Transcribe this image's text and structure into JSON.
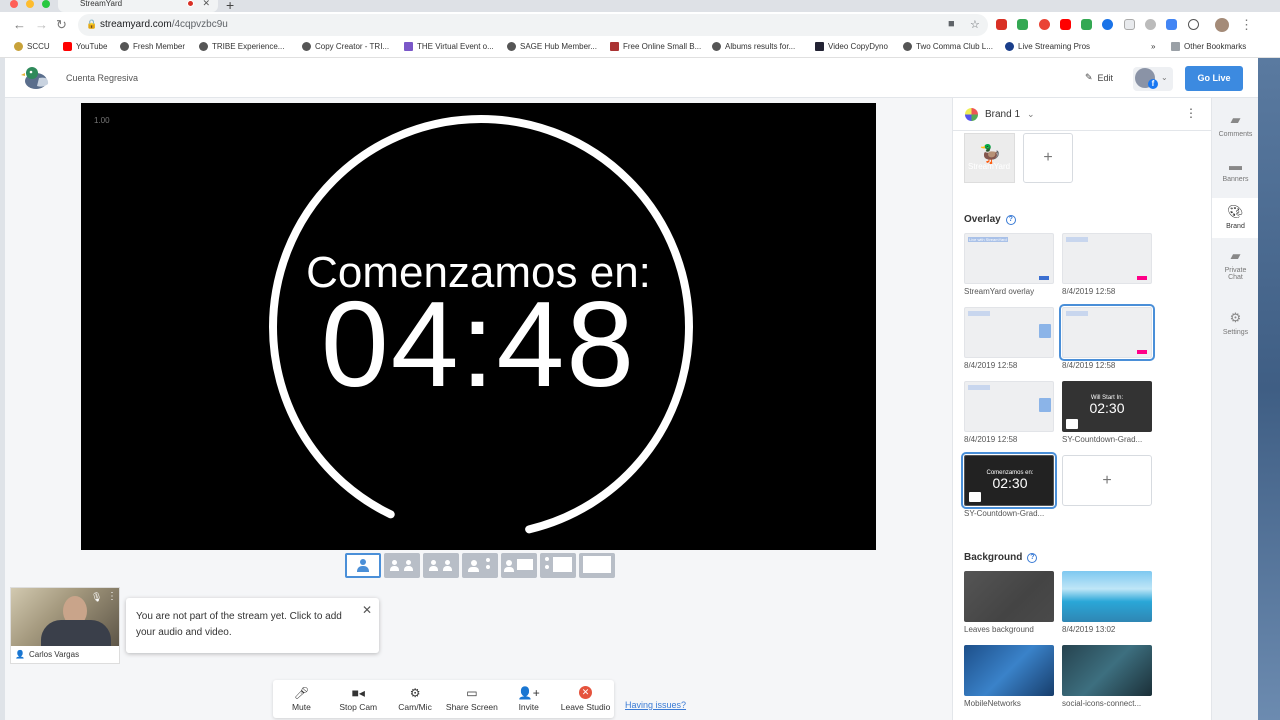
{
  "browser": {
    "tab_title": "StreamYard",
    "url_host": "streamyard.com",
    "url_path": "/4cqpvzbc9u",
    "bookmarks": [
      "SCCU",
      "YouTube",
      "Fresh Member",
      "TRIBE Experience...",
      "Copy Creator - TRI...",
      "THE Virtual Event o...",
      "SAGE Hub Member...",
      "Free Online Small B...",
      "Albums results for...",
      "Video CopyDyno",
      "Two Comma Club L...",
      "Live Streaming Pros"
    ],
    "bookmarks_more": "»",
    "other_bookmarks": "Other Bookmarks"
  },
  "header": {
    "title": "Cuenta Regresiva",
    "edit_label": "Edit",
    "go_live_label": "Go Live"
  },
  "stage": {
    "version": "1.00",
    "label": "Comenzamos en:",
    "time": "04:48"
  },
  "self_view": {
    "name": "Carlos Vargas"
  },
  "toast": {
    "message": "You are not part of the stream yet. Click to add your audio and video."
  },
  "controls": {
    "mute": "Mute",
    "stop_cam": "Stop Cam",
    "cam_mic": "Cam/Mic",
    "share_screen": "Share Screen",
    "invite": "Invite",
    "leave_studio": "Leave Studio"
  },
  "having_issues": "Having issues?",
  "panel": {
    "brand_name": "Brand 1",
    "logo_text": "StreamYard",
    "overlay_title": "Overlay",
    "overlays": [
      {
        "caption": "StreamYard overlay"
      },
      {
        "caption": "8/4/2019 12:58"
      },
      {
        "caption": "8/4/2019 12:58"
      },
      {
        "caption": "8/4/2019 12:58"
      },
      {
        "caption": "8/4/2019 12:58"
      },
      {
        "caption": "SY-Countdown-Grad...",
        "label": "Will Start In:",
        "time": "02:30"
      },
      {
        "caption": "SY-Countdown-Grad...",
        "label": "Comenzamos en:",
        "time": "02:30"
      }
    ],
    "overlay_mini_label": "Live with StreamYard",
    "background_title": "Background",
    "backgrounds": [
      {
        "caption": "Leaves background"
      },
      {
        "caption": "8/4/2019 13:02"
      },
      {
        "caption": "MobileNetworks"
      },
      {
        "caption": "social-icons-connect..."
      }
    ]
  },
  "rail": {
    "comments": "Comments",
    "banners": "Banners",
    "brand": "Brand",
    "private_chat_1": "Private",
    "private_chat_2": "Chat",
    "settings": "Settings"
  },
  "colors": {
    "accent": "#3c8ae0",
    "leave": "#e5533d",
    "link": "#3a7bd5"
  }
}
